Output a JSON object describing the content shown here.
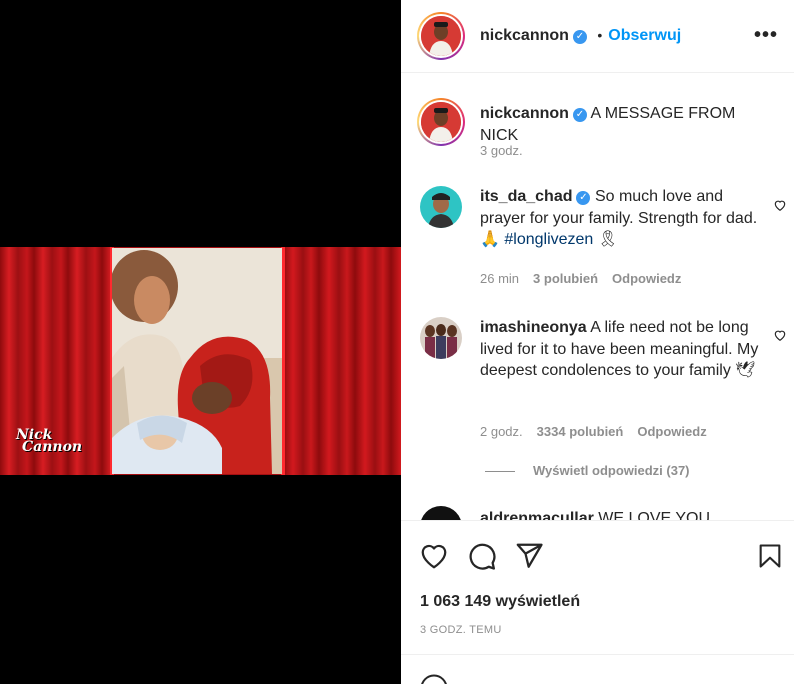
{
  "video": {
    "logo_line1": "Nick",
    "logo_line2": "Cannon"
  },
  "header": {
    "username": "nickcannon",
    "separator": "•",
    "follow_label": "Obserwuj",
    "more_icon": "more-horizontal-icon"
  },
  "caption": {
    "username": "nickcannon",
    "text": "A MESSAGE FROM NICK",
    "time": "3 godz."
  },
  "comments": [
    {
      "username": "its_da_chad",
      "verified": true,
      "text": "So much love and prayer for your family. Strength for dad. 🙏 ",
      "hashtag": "#longlivezen",
      "suffix": " 🎗",
      "time": "26 min",
      "likes": "3 polubień",
      "reply": "Odpowiedz"
    },
    {
      "username": "imashineonya",
      "verified": false,
      "text": "A life need not be long lived for it to have been meaningful. My deepest condolences to your family 🕊",
      "time": "2 godz.",
      "likes": "3334 polubień",
      "reply": "Odpowiedz"
    }
  ],
  "view_replies": "Wyświetl odpowiedzi (37)",
  "partial_comment": {
    "username": "aldrenmacullar",
    "text": "WE LOVE YOU"
  },
  "actions": {
    "views": "1 063 149 wyświetleń",
    "timestamp": "3 GODZ. TEMU"
  },
  "colors": {
    "accent": "#0095f6",
    "verified": "#3897f0",
    "hashtag": "#00376b",
    "muted": "#8e8e8e"
  }
}
